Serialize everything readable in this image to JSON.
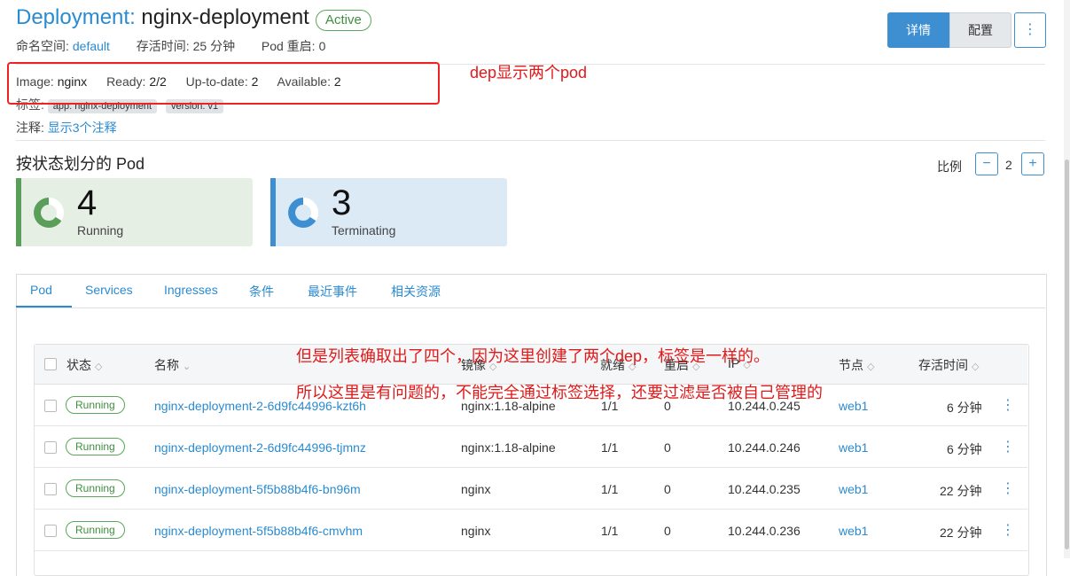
{
  "header": {
    "kind": "Deployment:",
    "name": "nginx-deployment",
    "status": "Active",
    "namespace_label": "命名空间:",
    "namespace": "default",
    "age_label": "存活时间:",
    "age": "25 分钟",
    "restarts_label": "Pod 重启:",
    "restarts": "0"
  },
  "actions": {
    "detail": "详情",
    "config": "配置",
    "more": "⋮"
  },
  "info": {
    "image_label": "Image:",
    "image": "nginx",
    "ready_label": "Ready:",
    "ready": "2/2",
    "uptodate_label": "Up-to-date:",
    "uptodate": "2",
    "available_label": "Available:",
    "available": "2",
    "labels_label": "标签:",
    "labels": [
      "app: nginx-deployment",
      "version: v1"
    ],
    "annotations_label": "注释:",
    "annotations_link": "显示3个注释"
  },
  "annotations_overlay": {
    "note1": "dep显示两个pod",
    "note2": "但是列表确取出了四个，因为这里创建了两个dep，标签是一样的。",
    "note3": "所以这里是有问题的，不能完全通过标签选择，还要过滤是否被自己管理的"
  },
  "pods_by_status": {
    "title": "按状态划分的 Pod",
    "scale_label": "比例",
    "scale_value": "2",
    "minus": "−",
    "plus": "+",
    "cards": [
      {
        "count": "4",
        "label": "Running",
        "color": "#5a9e5a",
        "bg": "#e6efe4"
      },
      {
        "count": "3",
        "label": "Terminating",
        "color": "#3d8fd1",
        "bg": "#dceaf6"
      }
    ]
  },
  "tabs": [
    "Pod",
    "Services",
    "Ingresses",
    "条件",
    "最近事件",
    "相关资源"
  ],
  "table": {
    "columns": [
      "状态",
      "名称",
      "镜像",
      "就绪",
      "重启",
      "IP",
      "节点",
      "存活时间"
    ],
    "rows": [
      {
        "status": "Running",
        "name": "nginx-deployment-2-6d9fc44996-kzt6h",
        "image": "nginx:1.18-alpine",
        "ready": "1/1",
        "restarts": "0",
        "ip": "10.244.0.245",
        "node": "web1",
        "age": "6 分钟"
      },
      {
        "status": "Running",
        "name": "nginx-deployment-2-6d9fc44996-tjmnz",
        "image": "nginx:1.18-alpine",
        "ready": "1/1",
        "restarts": "0",
        "ip": "10.244.0.246",
        "node": "web1",
        "age": "6 分钟"
      },
      {
        "status": "Running",
        "name": "nginx-deployment-5f5b88b4f6-bn96m",
        "image": "nginx",
        "ready": "1/1",
        "restarts": "0",
        "ip": "10.244.0.235",
        "node": "web1",
        "age": "22 分钟"
      },
      {
        "status": "Running",
        "name": "nginx-deployment-5f5b88b4f6-cmvhm",
        "image": "nginx",
        "ready": "1/1",
        "restarts": "0",
        "ip": "10.244.0.236",
        "node": "web1",
        "age": "22 分钟"
      }
    ]
  },
  "icons": {
    "sort": "sort-icon",
    "kebab": "kebab-icon",
    "donut": "donut-icon"
  }
}
